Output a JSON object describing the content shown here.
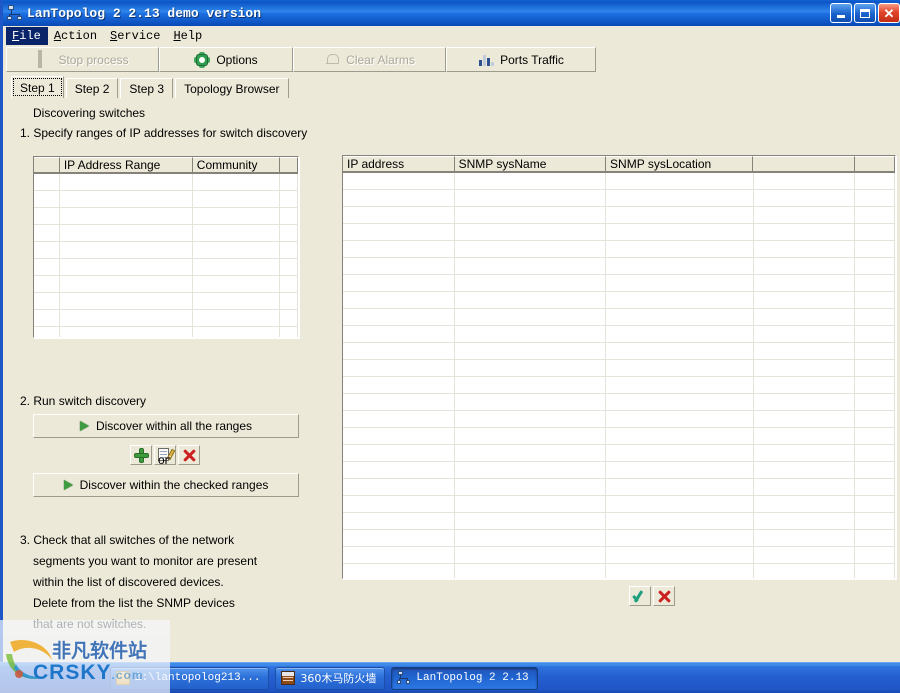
{
  "window": {
    "title": "LanTopolog 2 2.13 demo version",
    "icon": "network-topology-icon",
    "minimize_label": "Minimize",
    "maximize_label": "Maximize",
    "close_label": "Close"
  },
  "menubar": {
    "items": [
      {
        "label": "File",
        "accel": "F",
        "selected": true
      },
      {
        "label": "Action",
        "accel": "A",
        "selected": false
      },
      {
        "label": "Service",
        "accel": "S",
        "selected": false
      },
      {
        "label": "Help",
        "accel": "H",
        "selected": false
      }
    ]
  },
  "toolbar": {
    "buttons": [
      {
        "label": "Stop process",
        "icon": "stop-square-icon",
        "enabled": false
      },
      {
        "label": "Options",
        "icon": "gear-icon",
        "enabled": true
      },
      {
        "label": "Clear Alarms",
        "icon": "bell-icon",
        "enabled": false
      },
      {
        "label": "Ports Traffic",
        "icon": "bar-chart-icon",
        "enabled": true
      }
    ]
  },
  "tabs": {
    "items": [
      {
        "label": "Step 1",
        "active": true
      },
      {
        "label": "Step 2",
        "active": false
      },
      {
        "label": "Step 3",
        "active": false
      },
      {
        "label": "Topology Browser",
        "active": false
      }
    ]
  },
  "left_panel": {
    "heading": "Discovering switches",
    "step1_text": "1. Specify ranges of IP addresses for switch discovery",
    "ranges_grid": {
      "columns": [
        "",
        "IP Address Range",
        "Community",
        ""
      ],
      "rows": [],
      "empty_row_count": 11
    },
    "row_buttons": [
      {
        "name": "add-range-button",
        "icon": "plus-icon"
      },
      {
        "name": "edit-range-button",
        "icon": "edit-icon"
      },
      {
        "name": "delete-range-button",
        "icon": "red-x-icon"
      }
    ],
    "step2_text": "2. Run switch discovery",
    "discover_all_label": "Discover within all the ranges",
    "or_label": "or",
    "discover_checked_label": "Discover within the checked ranges",
    "step3_lines": [
      "3. Check that all switches of the network",
      "segments you want to monitor are present",
      "within the list of discovered devices.",
      "Delete from the list the SNMP devices",
      "that are not switches."
    ]
  },
  "right_panel": {
    "devices_grid": {
      "columns": [
        "IP address",
        "SNMP sysName",
        "SNMP sysLocation",
        "",
        ""
      ],
      "rows": [],
      "empty_row_count": 24
    },
    "action_buttons": [
      {
        "name": "accept-devices-button",
        "icon": "green-check-icon"
      },
      {
        "name": "delete-devices-button",
        "icon": "red-x-icon"
      }
    ]
  },
  "taskbar": {
    "items": [
      {
        "label": "Z:\\lantopolog213...",
        "icon": "folder-icon",
        "active": false,
        "cjk": false
      },
      {
        "label": "360木马防火墙",
        "icon": "firewall-icon",
        "active": false,
        "cjk": true
      },
      {
        "label": "LanTopolog 2 2.13",
        "icon": "network-topology-icon",
        "active": true,
        "cjk": false
      }
    ]
  },
  "watermark": {
    "cn_text": "非凡软件站",
    "en_text": "CRSKY",
    "en_suffix": ".com"
  },
  "colors": {
    "window_face": "#ece9d8",
    "titlebar_blue": "#1163d6",
    "desktop_blue": "#2a5bc8",
    "accent_green": "#3f9b3f",
    "accent_red": "#cc2020",
    "grid_line": "#e6e4da"
  }
}
